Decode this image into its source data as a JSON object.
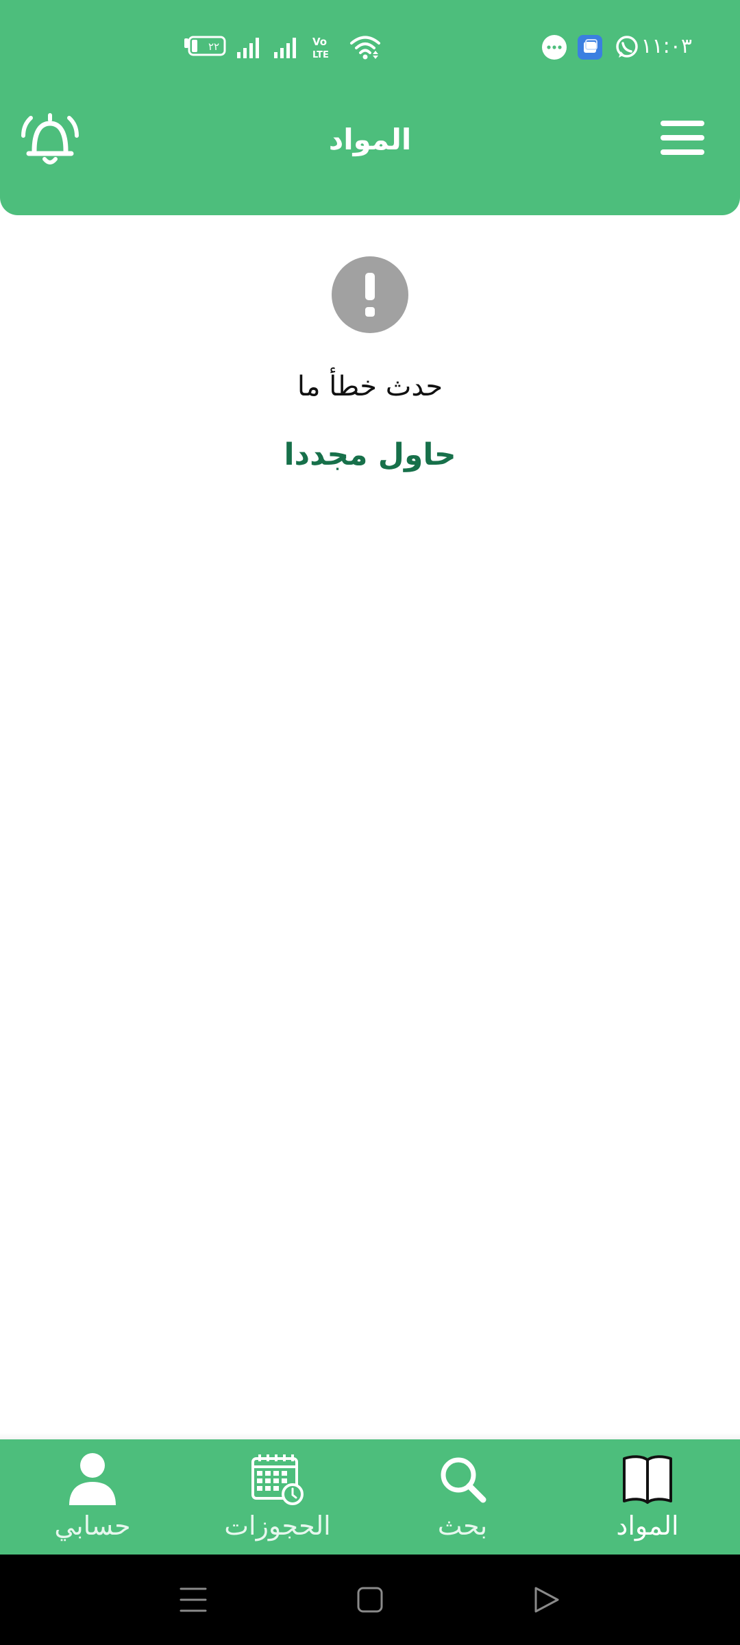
{
  "status_bar": {
    "time": "١١:٠٣",
    "battery_level": "٢٢",
    "network_label": "Vo LTE",
    "icons": [
      "messages-icon",
      "app-icon",
      "whatsapp-icon",
      "wifi-icon",
      "volte-icon",
      "signal-icon",
      "signal-icon",
      "battery-icon"
    ]
  },
  "header": {
    "title": "المواد",
    "menu_icon": "hamburger-menu-icon",
    "notification_icon": "bell-ringing-icon"
  },
  "error_state": {
    "icon": "exclamation-circle-icon",
    "message": "حدث خطأ ما",
    "retry_label": "حاول مجددا"
  },
  "bottom_nav": {
    "items": [
      {
        "label": "المواد",
        "icon": "book-icon",
        "active": true
      },
      {
        "label": "بحث",
        "icon": "search-icon",
        "active": false
      },
      {
        "label": "الحجوزات",
        "icon": "calendar-clock-icon",
        "active": false
      },
      {
        "label": "حسابي",
        "icon": "user-icon",
        "active": false
      }
    ]
  },
  "system_nav": {
    "buttons": [
      "recents-icon",
      "home-icon",
      "back-icon"
    ]
  },
  "colors": {
    "primary": "#4dbe7c",
    "retry_text": "#17704a",
    "error_icon": "#a1a1a1",
    "system_bar": "#000000"
  }
}
